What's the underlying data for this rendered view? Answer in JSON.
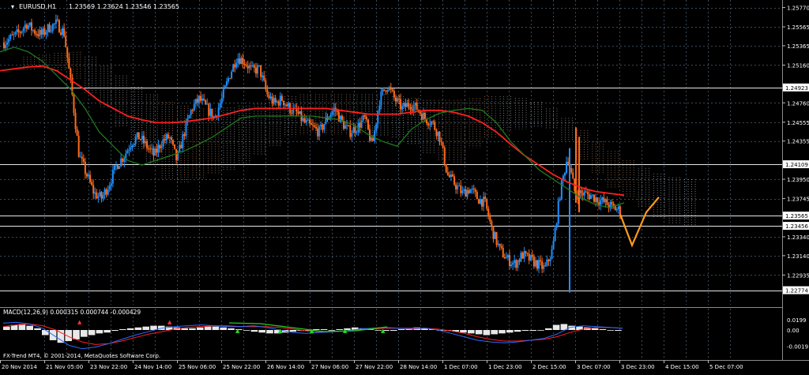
{
  "app": {
    "title": "FX-Trend MT4, © 2001-2014, MetaQuotes Software Corp."
  },
  "header": {
    "symbol_tf": "EURUSD,H1",
    "ohlc": "1.23569 1.23624 1.23546 1.23565"
  },
  "colors": {
    "background": "#000000",
    "grid": "#3a4a5a",
    "up": "#1e90ff",
    "down": "#ff6a1a",
    "ma_fast": "#1f7a1f",
    "ma_slow": "#ff2020",
    "cloud": "#c8c8c8",
    "cloud_alt": "#d9a27a",
    "projection": "#ff9a1a",
    "label_bg": "#ffffff",
    "label_fg": "#000000"
  },
  "chart_data": [
    {
      "type": "candlestick",
      "symbol": "EURUSD",
      "timeframe": "H1",
      "y_ticks": [
        "1.25770",
        "1.25565",
        "1.25365",
        "1.25160",
        "1.24760",
        "1.24555",
        "1.24355",
        "1.23950",
        "1.23745",
        "1.23340",
        "1.23140",
        "1.22935"
      ],
      "price_labels": [
        "1.24923",
        "1.24109",
        "1.23565",
        "1.23456",
        "1.22774"
      ],
      "horizontal_lines": [
        1.24923,
        1.24109,
        1.23565,
        1.23456,
        1.22774
      ],
      "x_ticks": [
        "20 Nov 2014",
        "21 Nov 05:00",
        "23 Nov 22:00",
        "24 Nov 14:00",
        "25 Nov 06:00",
        "25 Nov 22:00",
        "26 Nov 14:00",
        "27 Nov 06:00",
        "27 Nov 22:00",
        "28 Nov 14:00",
        "1 Dec 07:00",
        "1 Dec 23:00",
        "2 Dec 15:00",
        "3 Dec 07:00",
        "3 Dec 23:00",
        "4 Dec 15:00",
        "5 Dec 07:00"
      ],
      "ylim": [
        1.2262,
        1.2585
      ],
      "close_path": [
        1.254,
        1.2545,
        1.255,
        1.256,
        1.2552,
        1.2548,
        1.2556,
        1.256,
        1.255,
        1.249,
        1.242,
        1.24,
        1.238,
        1.2375,
        1.239,
        1.241,
        1.242,
        1.2435,
        1.244,
        1.243,
        1.242,
        1.2435,
        1.244,
        1.2415,
        1.2445,
        1.247,
        1.248,
        1.247,
        1.246,
        1.248,
        1.2505,
        1.2525,
        1.252,
        1.251,
        1.2512,
        1.2485,
        1.2475,
        1.248,
        1.247,
        1.2465,
        1.2455,
        1.245,
        1.2445,
        1.246,
        1.247,
        1.2455,
        1.2445,
        1.245,
        1.246,
        1.243,
        1.248,
        1.2495,
        1.248,
        1.247,
        1.2475,
        1.247,
        1.246,
        1.2455,
        1.244,
        1.24,
        1.239,
        1.238,
        1.2385,
        1.2375,
        1.237,
        1.234,
        1.232,
        1.231,
        1.2305,
        1.2315,
        1.231,
        1.2305,
        1.23,
        1.232,
        1.238,
        1.242,
        1.238,
        1.238,
        1.2378,
        1.2374,
        1.237,
        1.2365,
        1.2362
      ],
      "ma_fast": [
        1.253,
        1.2535,
        1.253,
        1.252,
        1.2505,
        1.249,
        1.247,
        1.2445,
        1.243,
        1.2415,
        1.241,
        1.2415,
        1.242,
        1.2425,
        1.2432,
        1.244,
        1.245,
        1.246,
        1.2462,
        1.2462,
        1.2462,
        1.2462,
        1.2462,
        1.246,
        1.2458,
        1.2452,
        1.2442,
        1.2435,
        1.243,
        1.2448,
        1.2458,
        1.2465,
        1.2468,
        1.247,
        1.2468,
        1.2455,
        1.2435,
        1.242,
        1.2405,
        1.2395,
        1.2385,
        1.2375,
        1.2368,
        1.2365,
        1.237
      ],
      "ma_slow": [
        1.251,
        1.2512,
        1.2514,
        1.2515,
        1.251,
        1.25,
        1.249,
        1.2478,
        1.247,
        1.2462,
        1.2458,
        1.2455,
        1.2455,
        1.2456,
        1.2458,
        1.246,
        1.2464,
        1.2468,
        1.247,
        1.247,
        1.247,
        1.247,
        1.247,
        1.247,
        1.2468,
        1.2466,
        1.2464,
        1.2464,
        1.2464,
        1.2466,
        1.2468,
        1.2468,
        1.2466,
        1.2462,
        1.2455,
        1.2445,
        1.2432,
        1.242,
        1.241,
        1.24,
        1.2392,
        1.2386,
        1.2382,
        1.238,
        1.2378
      ],
      "projection": [
        1.2358,
        1.2325,
        1.236,
        1.2376
      ]
    },
    {
      "type": "bar",
      "title": "MACD(12,26,9) 0.000315 0.000744 -0.000429",
      "indicator": "MACD(12,26,9)",
      "values_text": "0.000315 0.000744 -0.000429",
      "y_ticks": [
        "0.0199",
        "0.00",
        "-0.0019"
      ],
      "ylim": [
        -0.0025,
        0.0025
      ],
      "histogram": [
        0.0004,
        0.0006,
        0.0007,
        0.0005,
        0.0002,
        -0.0006,
        -0.0012,
        -0.0015,
        -0.0013,
        -0.0011,
        -0.0008,
        -0.0006,
        -0.0004,
        -0.0003,
        -0.0001,
        0.0001,
        0.0002,
        0.0003,
        0.0004,
        0.0005,
        0.0005,
        0.0004,
        0.0003,
        0.0002,
        0.0002,
        0.0003,
        0.0004,
        0.0004,
        0.0003,
        0.0002,
        0.0001,
        0.0,
        -0.0002,
        -0.0003,
        -0.0004,
        -0.0004,
        -0.0003,
        -0.0002,
        -0.0001,
        0.0,
        0.0001,
        0.0001,
        0.0,
        0.0001,
        0.0002,
        0.0003,
        0.0002,
        0.0001,
        0.0,
        -0.0001,
        -0.0001,
        0.0001,
        0.0002,
        0.0003,
        0.0002,
        0.0001,
        0.0,
        -0.0001,
        -0.0002,
        -0.0003,
        -0.0004,
        -0.0005,
        -0.0006,
        -0.0005,
        -0.0004,
        -0.0003,
        -0.0002,
        -0.0001,
        -0.0001,
        0.0,
        0.0002,
        0.0006,
        0.0007,
        0.0005,
        0.0004,
        0.0003,
        0.0002,
        0.0001,
        0.0,
        -0.0001
      ],
      "macd_line": [
        0.0008,
        0.0009,
        0.0007,
        0.0002,
        -0.0008,
        -0.0018,
        -0.0022,
        -0.002,
        -0.0016,
        -0.0011,
        -0.0006,
        -0.0002,
        0.0002,
        0.0004,
        0.0005,
        0.0006,
        0.0005,
        0.0004,
        0.0004,
        0.0005,
        0.0003,
        0.0,
        -0.0003,
        -0.0004,
        -0.0003,
        -0.0002,
        -0.0001,
        0.0001,
        0.0002,
        0.0003,
        0.0002,
        0.0001,
        0.0002,
        0.0,
        -0.0004,
        -0.0008,
        -0.0012,
        -0.0014,
        -0.0015,
        -0.0014,
        -0.0012,
        -0.001,
        -0.0005,
        0.0003,
        0.0005,
        0.0004,
        0.0003,
        0.0002
      ],
      "signal_line": [
        0.0004,
        0.0006,
        0.0007,
        0.0005,
        0.0,
        -0.0008,
        -0.0014,
        -0.0017,
        -0.0016,
        -0.0013,
        -0.0009,
        -0.0005,
        -0.0002,
        0.0001,
        0.0003,
        0.0004,
        0.0005,
        0.0005,
        0.0004,
        0.0004,
        0.0004,
        0.0003,
        0.0001,
        -0.0001,
        -0.0002,
        -0.0002,
        -0.0001,
        0.0,
        0.0001,
        0.0002,
        0.0002,
        0.0002,
        0.0002,
        0.0001,
        -0.0001,
        -0.0004,
        -0.0008,
        -0.0011,
        -0.0013,
        -0.0013,
        -0.0012,
        -0.0011,
        -0.0008,
        -0.0003,
        0.0001,
        0.0003,
        0.0003,
        0.0002
      ]
    }
  ]
}
